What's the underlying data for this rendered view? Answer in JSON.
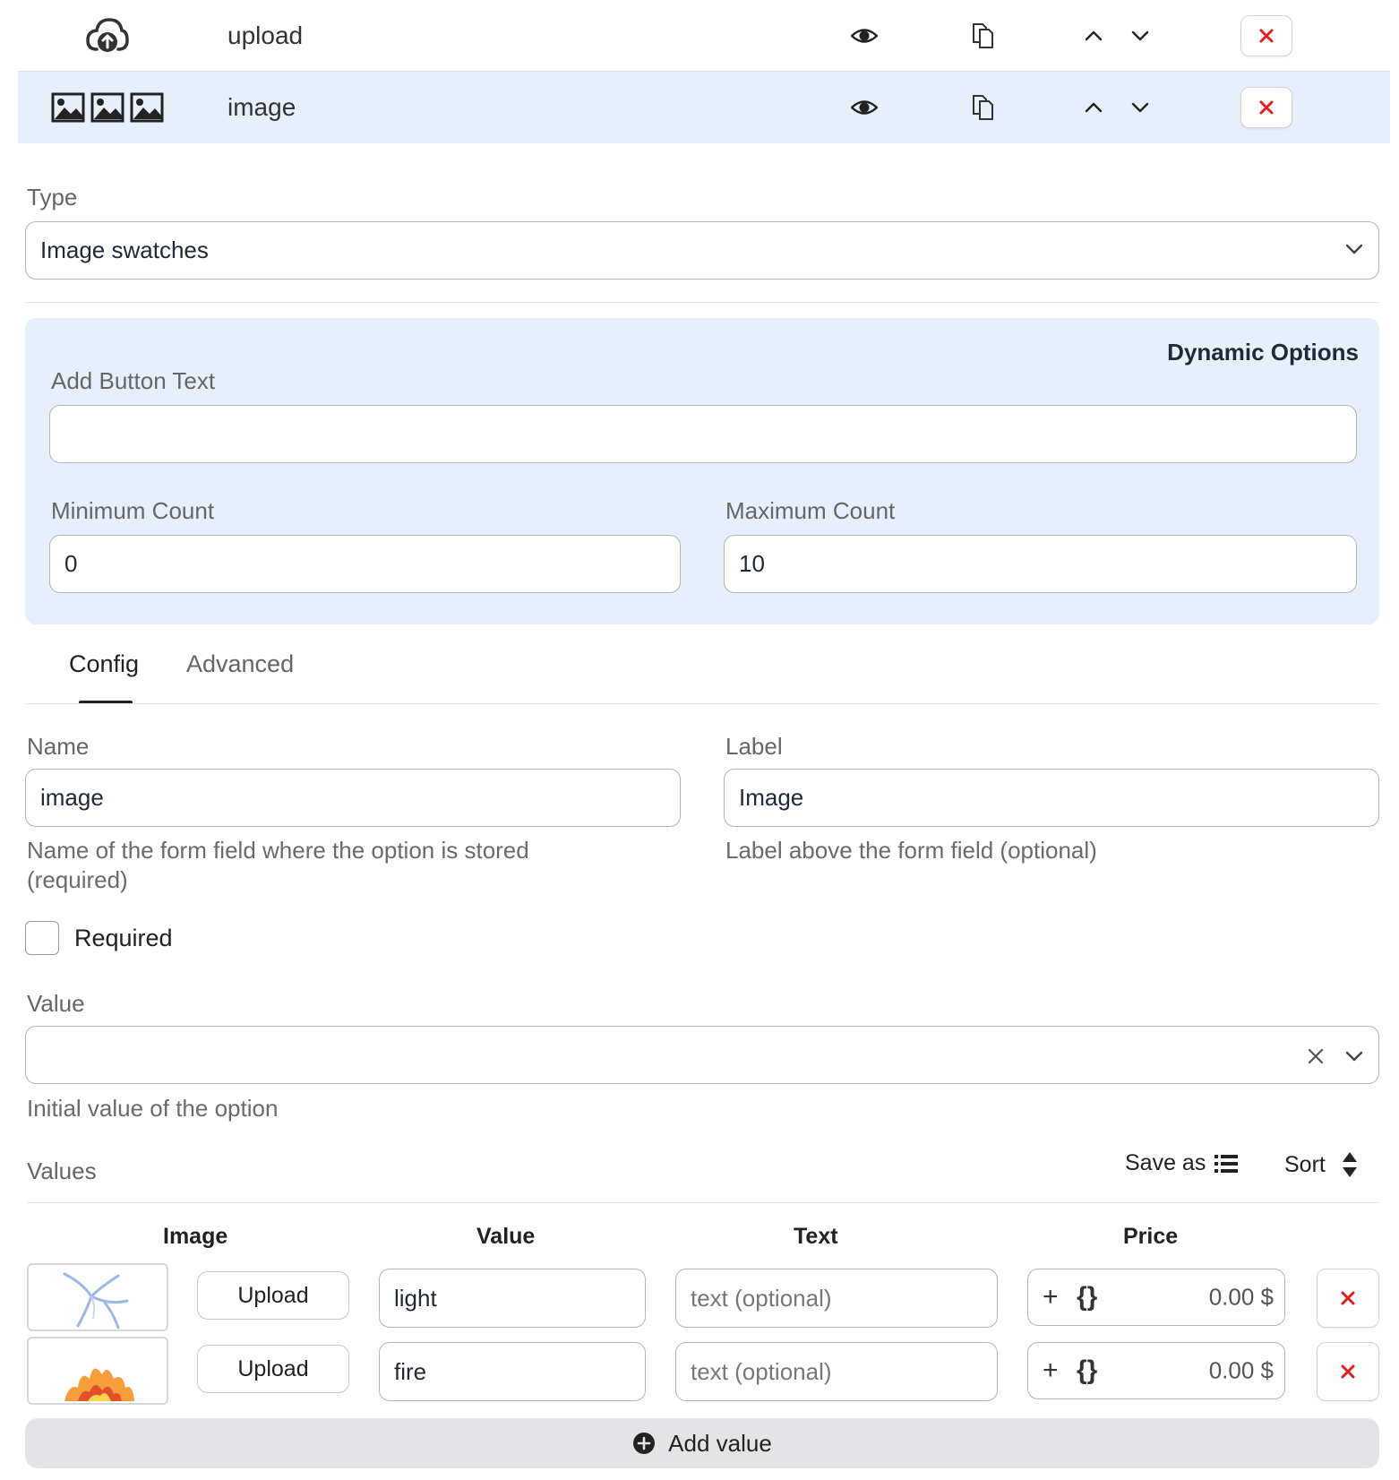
{
  "rows": [
    {
      "name": "upload",
      "icon": "cloud-upload-icon"
    },
    {
      "name": "image",
      "icon": "image-icon"
    }
  ],
  "type_field": {
    "label": "Type",
    "value": "Image swatches"
  },
  "dynamic": {
    "title": "Dynamic Options",
    "add_button_label": "Add Button Text",
    "add_button_value": "",
    "min_label": "Minimum Count",
    "min_value": "0",
    "max_label": "Maximum Count",
    "max_value": "10"
  },
  "tabs": [
    "Config",
    "Advanced"
  ],
  "name_field": {
    "label": "Name",
    "value": "image",
    "hint": "Name of the form field where the option is stored (required)"
  },
  "label_field": {
    "label": "Label",
    "value": "Image",
    "hint": "Label above the form field (optional)"
  },
  "required": {
    "label": "Required",
    "checked": false
  },
  "value_field": {
    "label": "Value",
    "value": "",
    "hint": "Initial value of the option"
  },
  "values": {
    "title": "Values",
    "save_as": "Save as",
    "sort": "Sort",
    "headers": [
      "Image",
      "Value",
      "Text",
      "Price"
    ],
    "upload_label": "Upload",
    "text_placeholder": "text (optional)",
    "items": [
      {
        "value": "light",
        "price": "0.00 $"
      },
      {
        "value": "fire",
        "price": "0.00 $"
      }
    ],
    "add_value": "Add value"
  },
  "colors": {
    "accent": "#e7eefc",
    "delete": "#e11d1d"
  }
}
